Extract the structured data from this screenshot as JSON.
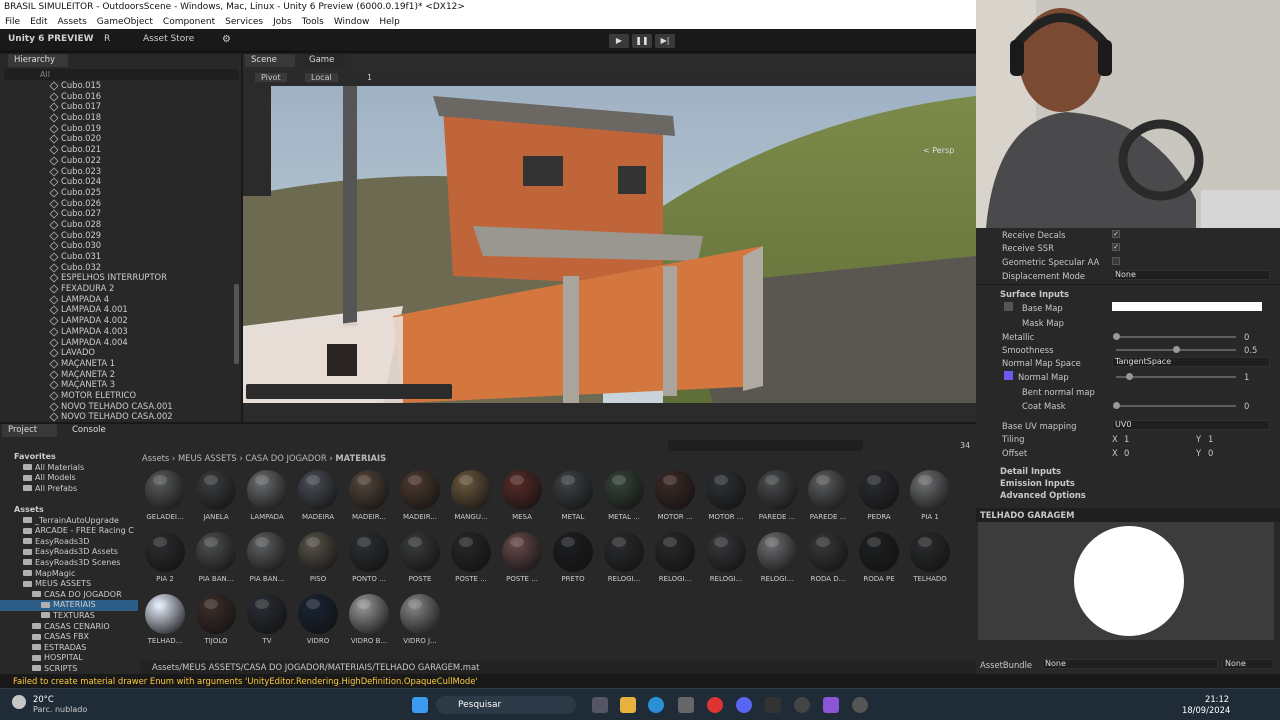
{
  "window": {
    "title": "BRASIL SIMULEITOR - OutdoorsScene - Windows, Mac, Linux - Unity 6 Preview (6000.0.19f1)* <DX12>"
  },
  "menu": [
    "File",
    "Edit",
    "Assets",
    "GameObject",
    "Component",
    "Services",
    "Jobs",
    "Tools",
    "Window",
    "Help"
  ],
  "toolbar": {
    "logo": "Unity 6 PREVIEW",
    "account": "R",
    "asset_store": "Asset Store"
  },
  "hierarchy": {
    "tab": "Hierarchy",
    "search_placeholder": "All",
    "items": [
      "Cubo.015",
      "Cubo.016",
      "Cubo.017",
      "Cubo.018",
      "Cubo.019",
      "Cubo.020",
      "Cubo.021",
      "Cubo.022",
      "Cubo.023",
      "Cubo.024",
      "Cubo.025",
      "Cubo.026",
      "Cubo.027",
      "Cubo.028",
      "Cubo.029",
      "Cubo.030",
      "Cubo.031",
      "Cubo.032",
      "ESPELHOS INTERRUPTOR",
      "FEXADURA 2",
      "LAMPADA 4",
      "LAMPADA 4.001",
      "LAMPADA 4.002",
      "LAMPADA 4.003",
      "LAMPADA 4.004",
      "LAVADO",
      "MAÇANETA 1",
      "MAÇANETA 2",
      "MAÇANETA 3",
      "MOTOR ELETRICO",
      "NOVO TELHADO CASA.001",
      "NOVO TELHADO CASA.002"
    ]
  },
  "scene": {
    "tabs": [
      "Scene",
      "Game"
    ],
    "pivot": "Pivot",
    "local": "Local",
    "grid_value": "1",
    "persp": "< Persp"
  },
  "project": {
    "tabs": [
      "Project",
      "Console"
    ],
    "breadcrumb": [
      "Assets",
      "MEUS ASSETS",
      "CASA DO JOGADOR",
      "MATERIAIS"
    ],
    "count": "34",
    "tree": [
      {
        "label": "Favorites",
        "lvl": 0,
        "bold": true
      },
      {
        "label": "All Materials",
        "lvl": 1
      },
      {
        "label": "All Models",
        "lvl": 1
      },
      {
        "label": "All Prefabs",
        "lvl": 1
      },
      {
        "label": "",
        "lvl": 0
      },
      {
        "label": "Assets",
        "lvl": 0,
        "bold": true
      },
      {
        "label": "_TerrainAutoUpgrade",
        "lvl": 1
      },
      {
        "label": "ARCADE - FREE Racing C",
        "lvl": 1
      },
      {
        "label": "EasyRoads3D",
        "lvl": 1
      },
      {
        "label": "EasyRoads3D Assets",
        "lvl": 1
      },
      {
        "label": "EasyRoads3D Scenes",
        "lvl": 1
      },
      {
        "label": "MapMagic",
        "lvl": 1
      },
      {
        "label": "MEUS ASSETS",
        "lvl": 1
      },
      {
        "label": "CASA DO JOGADOR",
        "lvl": 2
      },
      {
        "label": "MATERIAIS",
        "lvl": 3,
        "sel": true
      },
      {
        "label": "TEXTURAS",
        "lvl": 3
      },
      {
        "label": "CASAS CENARIO",
        "lvl": 2
      },
      {
        "label": "CASAS FBX",
        "lvl": 2
      },
      {
        "label": "ESTRADAS",
        "lvl": 2
      },
      {
        "label": "HOSPITAL",
        "lvl": 2
      },
      {
        "label": "SCRIPTS",
        "lvl": 2
      }
    ],
    "materials": [
      [
        "GELADEI...",
        "#5a5c5e"
      ],
      [
        "JANELA",
        "#3c3e40"
      ],
      [
        "LAMPADA",
        "#6a6c6e"
      ],
      [
        "MADEIRA",
        "#4a4e56"
      ],
      [
        "MADEIR...",
        "#55463a"
      ],
      [
        "MADEIR...",
        "#4e3a30"
      ],
      [
        "MANGU...",
        "#6d5a3e"
      ],
      [
        "MESA",
        "#5a2c28"
      ],
      [
        "METAL",
        "#3e4448"
      ],
      [
        "METAL ...",
        "#36453a"
      ],
      [
        "MOTOR ...",
        "#3e2a26"
      ],
      [
        "MOTOR ...",
        "#2e3236"
      ],
      [
        "PAREDE ...",
        "#4a4c4e"
      ],
      [
        "PAREDE ...",
        "#5c5e60"
      ],
      [
        "PEDRA",
        "#2a2c30"
      ],
      [
        "PIA 1",
        "#707274"
      ],
      [
        "PIA 2",
        "#2c2e30"
      ],
      [
        "PIA BAN...",
        "#4e5052"
      ],
      [
        "PIA BAN...",
        "#5e6062"
      ],
      [
        "PISO",
        "#5a544a"
      ],
      [
        "PONTO ...",
        "#2c3034"
      ],
      [
        "POSTE",
        "#3a3c3e"
      ],
      [
        "POSTE ...",
        "#262829"
      ],
      [
        "POSTE ...",
        "#6a4a4c"
      ],
      [
        "PRETO",
        "#1c1e20"
      ],
      [
        "RELOGI...",
        "#2a2c2e"
      ],
      [
        "RELOGI...",
        "#28292a"
      ],
      [
        "RELOGI...",
        "#36383a"
      ],
      [
        "RELOGI...",
        "#6e7072"
      ],
      [
        "RODA D...",
        "#38393a"
      ],
      [
        "RODA PE",
        "#1e2022"
      ],
      [
        "TELHADO",
        "#2a2c2e"
      ],
      [
        "TELHAD...",
        "#e8f0ff"
      ],
      [
        "TIJOLO",
        "#3e2e2a"
      ],
      [
        "TV",
        "#2a2e34"
      ],
      [
        "VIDRO",
        "#1a2436"
      ],
      [
        "VIDRO B...",
        "#9a9a9a"
      ],
      [
        "VIDRO J...",
        "#888888"
      ]
    ],
    "path": "Assets/MEUS ASSETS/CASA DO JOGADOR/MATERIAIS/TELHADO GARAGEM.mat"
  },
  "inspector": {
    "receive_decals": "Receive Decals",
    "receive_ssr": "Receive SSR",
    "geo_spec": "Geometric Specular AA",
    "displacement": "Displacement Mode",
    "displacement_val": "None",
    "surface": "Surface Inputs",
    "base_map": "Base Map",
    "mask_map": "Mask Map",
    "metallic": "Metallic",
    "metallic_val": "0",
    "smoothness": "Smoothness",
    "smoothness_val": "0.5",
    "normal_space": "Normal Map Space",
    "normal_space_val": "TangentSpace",
    "normal_map": "Normal Map",
    "normal_map_val": "1",
    "bent": "Bent normal map",
    "coat": "Coat Mask",
    "coat_val": "0",
    "uv": "Base UV mapping",
    "uv_val": "UV0",
    "tiling": "Tiling",
    "tiling_x": "1",
    "tiling_y": "1",
    "offset": "Offset",
    "offset_x": "0",
    "offset_y": "0",
    "x": "X",
    "y": "Y",
    "detail": "Detail Inputs",
    "emission": "Emission Inputs",
    "advanced": "Advanced Options",
    "preview_title": "TELHADO GARAGEM",
    "assetbundle": "AssetBundle",
    "ab_val": "None",
    "ab_val2": "None",
    "smoothness_level": 0.5
  },
  "status": {
    "message": "Failed to create material drawer Enum with arguments 'UnityEditor.Rendering.HighDefinition.OpaqueCullMode'"
  },
  "taskbar": {
    "temp": "20°C",
    "weather": "Parc. nublado",
    "search": "Pesquisar",
    "time": "21:12",
    "date": "18/09/2024"
  }
}
